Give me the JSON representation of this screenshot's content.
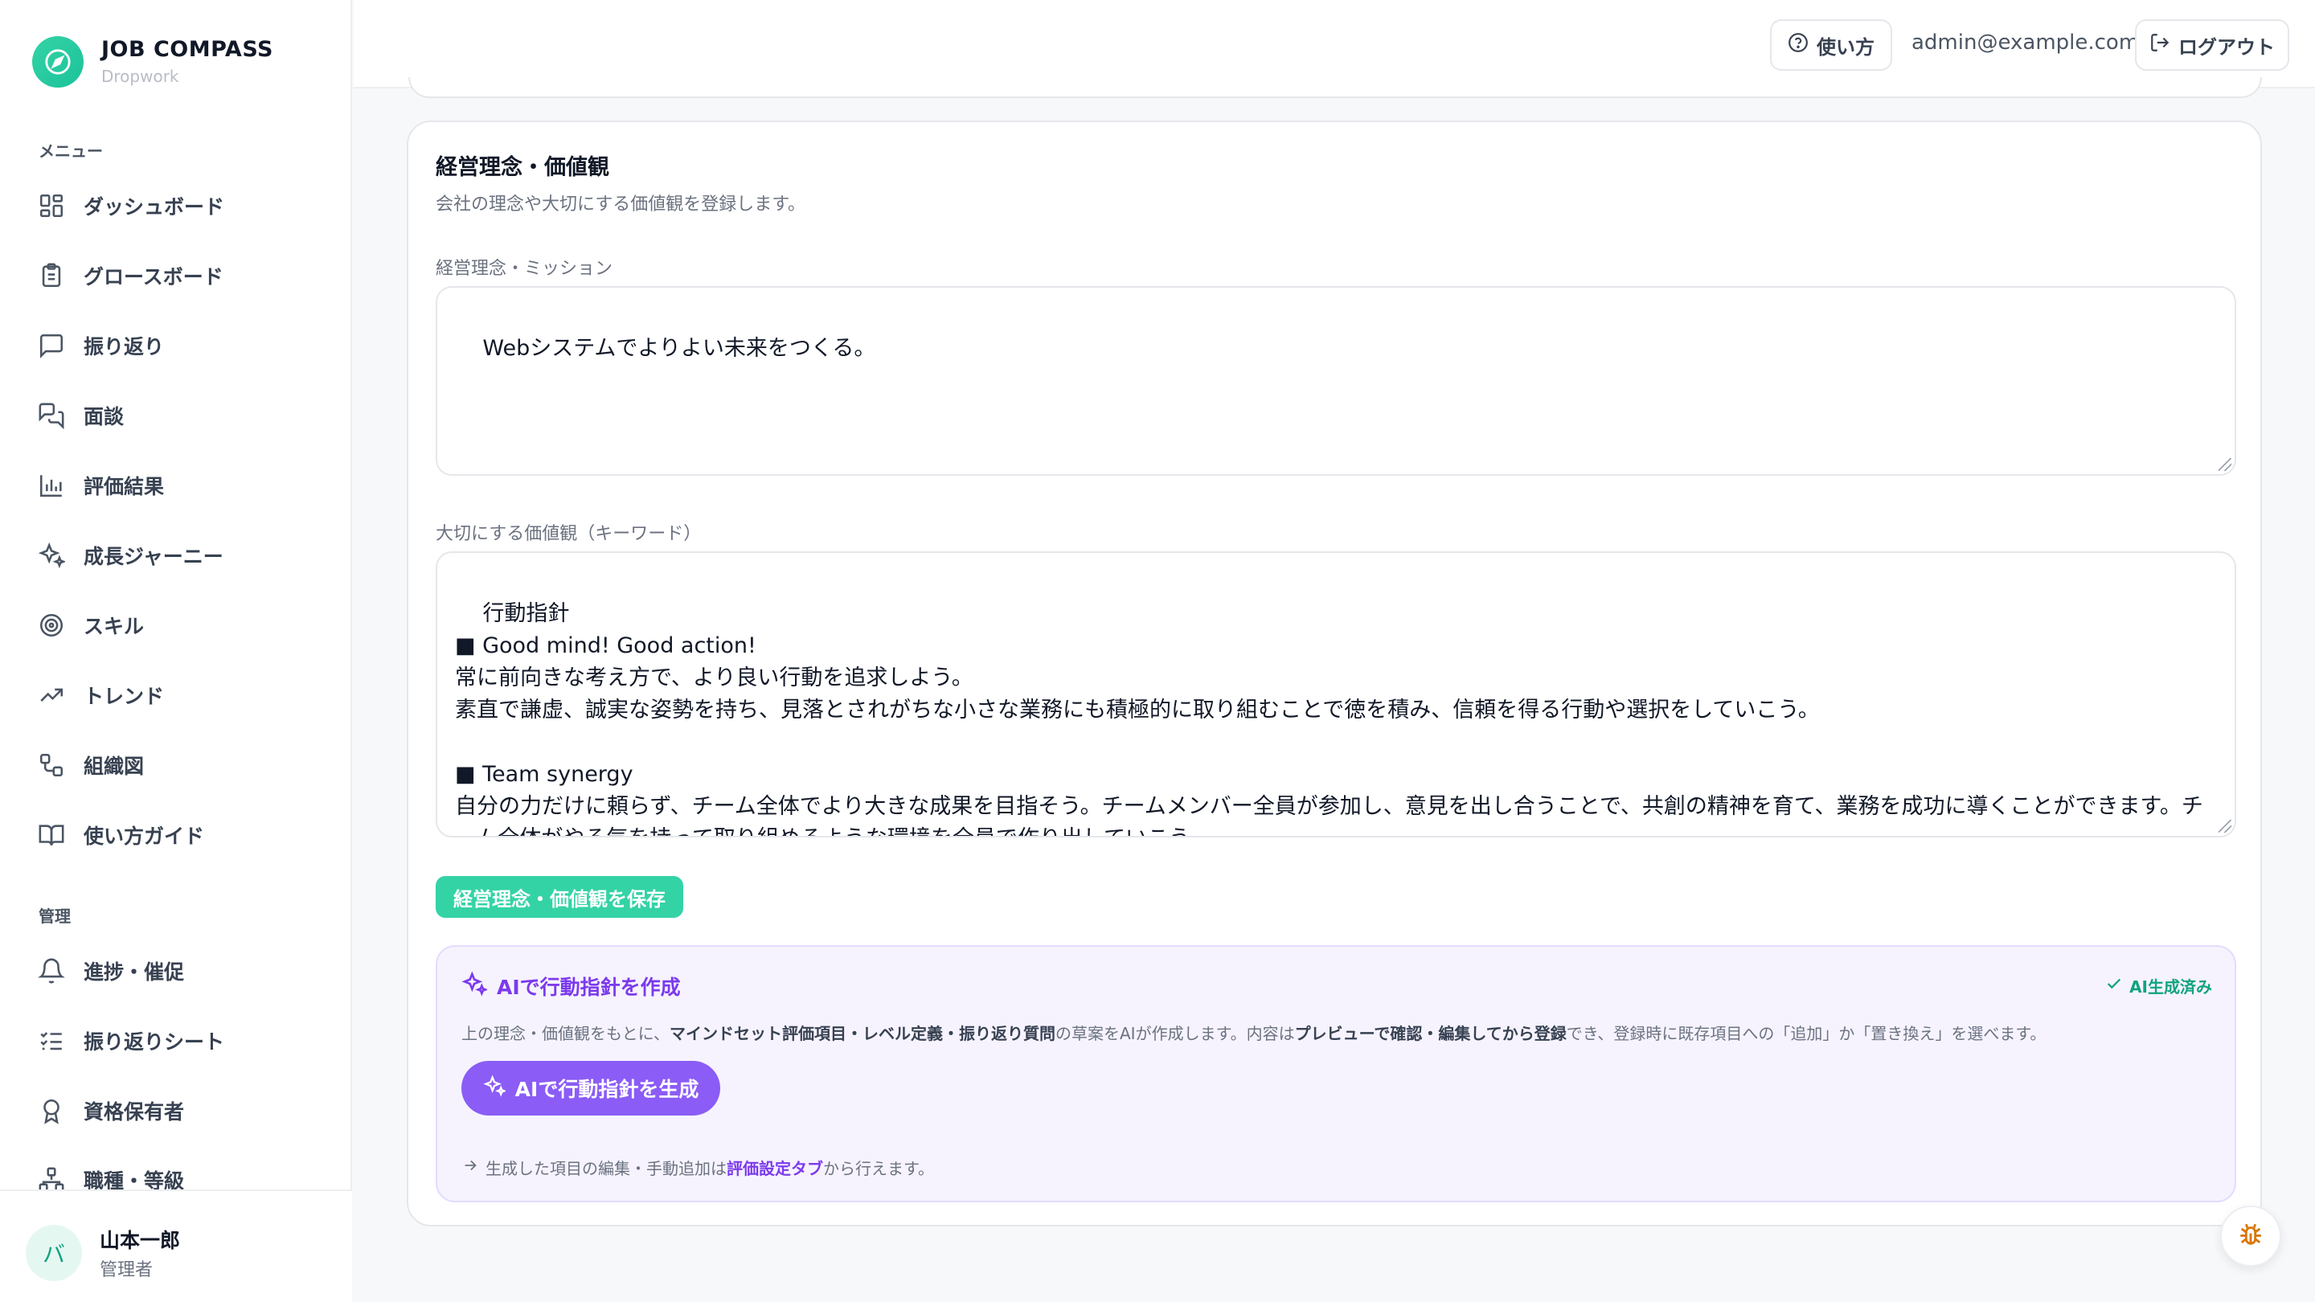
{
  "brand": {
    "title": "JOB COMPASS",
    "subtitle": "Dropwork"
  },
  "sidebar": {
    "menu_label": "メニュー",
    "menu_items": [
      {
        "label": "ダッシュボード",
        "icon": "dashboard-icon"
      },
      {
        "label": "グロースボード",
        "icon": "clipboard-icon"
      },
      {
        "label": "振り返り",
        "icon": "message-square-icon"
      },
      {
        "label": "面談",
        "icon": "messages-icon"
      },
      {
        "label": "評価結果",
        "icon": "bar-chart-icon"
      },
      {
        "label": "成長ジャーニー",
        "icon": "sparkles-icon"
      },
      {
        "label": "スキル",
        "icon": "target-icon"
      },
      {
        "label": "トレンド",
        "icon": "trending-up-icon"
      },
      {
        "label": "組織図",
        "icon": "org-chart-icon"
      },
      {
        "label": "使い方ガイド",
        "icon": "book-icon"
      }
    ],
    "admin_label": "管理",
    "admin_items": [
      {
        "label": "進捗・催促",
        "icon": "bell-icon"
      },
      {
        "label": "振り返りシート",
        "icon": "list-checks-icon"
      },
      {
        "label": "資格保有者",
        "icon": "award-icon"
      },
      {
        "label": "職種・等級",
        "icon": "sitemap-icon"
      }
    ],
    "user": {
      "avatar": "バ",
      "name": "山本一郎",
      "role": "管理者"
    }
  },
  "header": {
    "help_label": "使い方",
    "email": "admin@example.com",
    "logout_label": "ログアウト"
  },
  "card": {
    "title": "経営理念・価値観",
    "description": "会社の理念や大切にする価値観を登録します。",
    "mission_label": "経営理念・ミッション",
    "mission_value": "Webシステムでよりよい未来をつくる。",
    "values_label": "大切にする価値観（キーワード）",
    "values_value": "行動指針\n■ Good mind! Good action!\n常に前向きな考え方で、より良い行動を追求しよう。\n素直で謙虚、誠実な姿勢を持ち、見落とされがちな小さな業務にも積極的に取り組むことで徳を積み、信頼を得る行動や選択をしていこう。\n\n■ Team synergy\n自分の力だけに頼らず、チーム全体でより大きな成果を目指そう。チームメンバー全員が参加し、意見を出し合うことで、共創の精神を育て、業務を成功に導くことができます。チーム全体がやる気を持って取り組めるような環境を全員で作り出していこう。",
    "save_label": "経営理念・価値観を保存"
  },
  "ai": {
    "title": "AIで行動指針を作成",
    "status": "AI生成済み",
    "desc_parts": [
      "上の理念・価値観をもとに、",
      "マインドセット評価項目・レベル定義・振り返り質問",
      "の草案をAIが作成します。内容は",
      "プレビューで確認・編集してから登録",
      "でき、登録時に既存項目への「追加」か「置き換え」を選べます。"
    ],
    "button_label": "AIで行動指針を生成",
    "note_prefix": "生成した項目の編集・手動追加は",
    "note_link": "評価設定タブ",
    "note_suffix": "から行えます。"
  },
  "colors": {
    "accent": "#34d3a6",
    "ai": "#8b5cf6"
  }
}
